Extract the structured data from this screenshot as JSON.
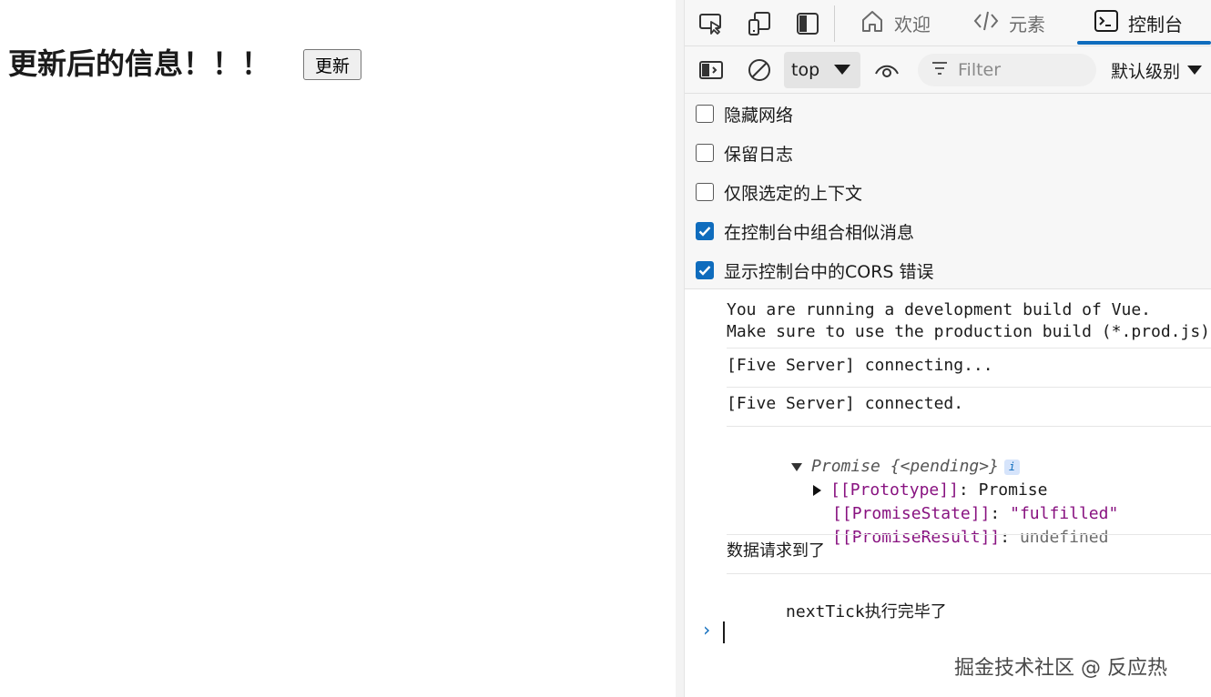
{
  "page": {
    "heading": "更新后的信息！！！",
    "update_button": "更新"
  },
  "devtools": {
    "tabs": [
      {
        "label": "欢迎",
        "icon": "home-icon"
      },
      {
        "label": "元素",
        "icon": "code-icon"
      },
      {
        "label": "控制台",
        "icon": "console-icon"
      }
    ],
    "active_tab": "控制台",
    "toolbar": {
      "context": "top",
      "filter_placeholder": "Filter",
      "level": "默认级别"
    },
    "settings": [
      {
        "label": "隐藏网络",
        "checked": false
      },
      {
        "label": "保留日志",
        "checked": false
      },
      {
        "label": "仅限选定的上下文",
        "checked": false
      },
      {
        "label": "在控制台中组合相似消息",
        "checked": true
      },
      {
        "label": "显示控制台中的CORS 错误",
        "checked": true
      }
    ],
    "console": {
      "vue_line1": "You are running a development build of Vue.",
      "vue_line2": "Make sure to use the production build (*.prod.js)",
      "five_connecting": "[Five Server] connecting...",
      "five_connected": "[Five Server] connected.",
      "promise_summary": "Promise {<pending>}",
      "info_badge": "i",
      "prototype_key": "[[Prototype]]",
      "prototype_val": "Promise",
      "state_key": "[[PromiseState]]",
      "state_val": "\"fulfilled\"",
      "result_key": "[[PromiseResult]]",
      "result_val": "undefined",
      "data_msg": "数据请求到了",
      "nexttick_code": "nextTick",
      "nexttick_rest": "执行完毕了",
      "prompt": "›"
    }
  },
  "watermark": "掘金技术社区 @ 反应热",
  "colors": {
    "accent": "#0f6cbd",
    "property": "#881280"
  }
}
